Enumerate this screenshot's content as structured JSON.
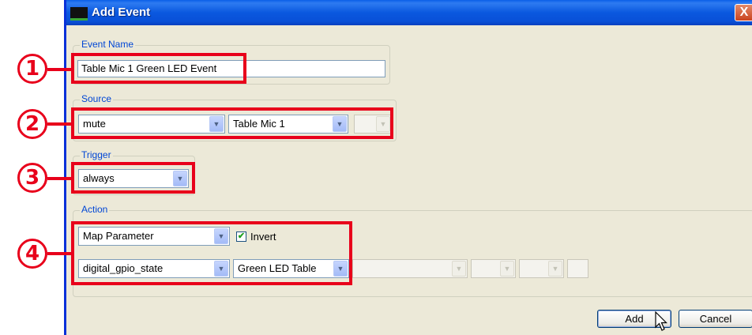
{
  "window": {
    "title": "Add Event",
    "close_glyph": "X"
  },
  "event_name": {
    "legend": "Event Name",
    "value": "Table Mic 1 Green LED Event"
  },
  "source": {
    "legend": "Source",
    "parameter": "mute",
    "device": "Table Mic 1",
    "extra": ""
  },
  "trigger": {
    "legend": "Trigger",
    "value": "always"
  },
  "action": {
    "legend": "Action",
    "type": "Map Parameter",
    "invert_label": "Invert",
    "invert_checked": true,
    "invert_check_glyph": "✔",
    "target_parameter": "digital_gpio_state",
    "target_device": "Green LED Table",
    "extra_1": "",
    "extra_2": "",
    "extra_3": "",
    "extra_4": ""
  },
  "buttons": {
    "add": "Add",
    "cancel": "Cancel"
  },
  "callouts": [
    "1",
    "2",
    "3",
    "4"
  ],
  "icons": {
    "dropdown": "chevron-down-icon",
    "close": "close-icon",
    "app": "app-icon",
    "cursor": "mouse-cursor-icon"
  },
  "colors": {
    "callout": "#e8001b",
    "titlebar": "#0a58df",
    "legend": "#0046d5",
    "dialog_bg": "#ece9d8"
  }
}
